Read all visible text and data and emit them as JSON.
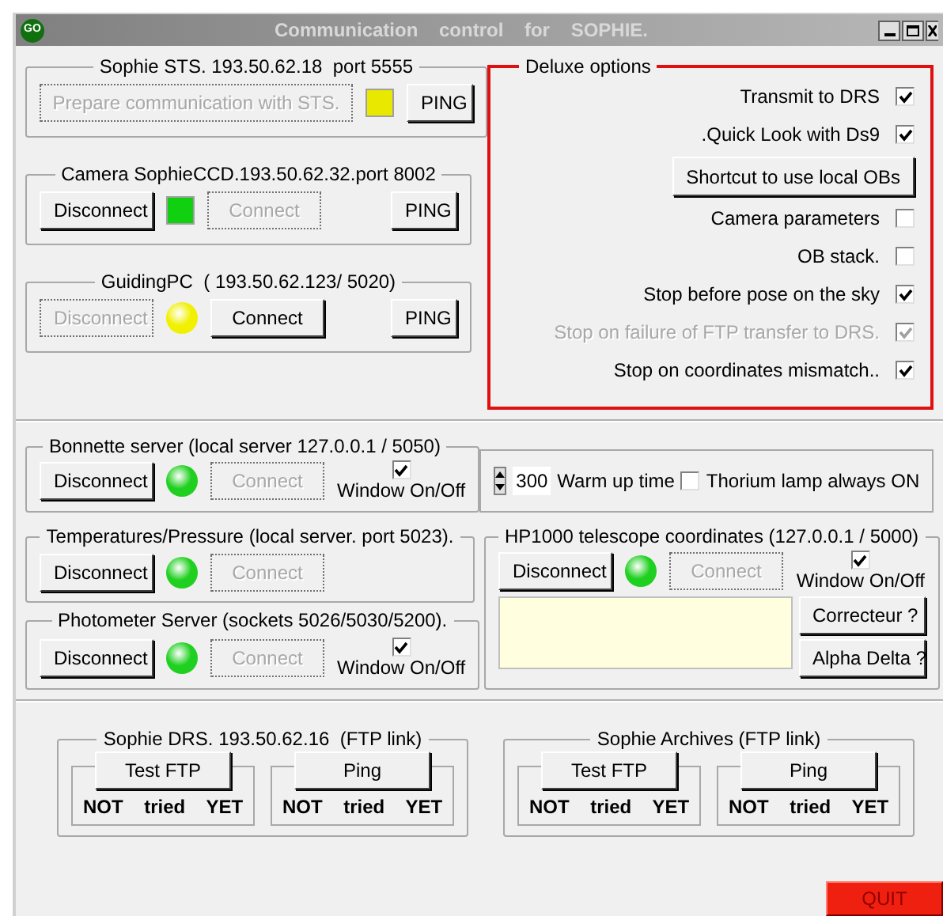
{
  "window": {
    "icon": "GO",
    "title": "Communication control for SOPHIE."
  },
  "connections": [
    {
      "title": "Sophie STS. 193.50.62.18  port 5555",
      "controls": [
        {
          "kind": "button",
          "label": "Prepare communication with STS.",
          "disabled": true
        },
        {
          "kind": "square_led",
          "color": "#e8e800"
        },
        {
          "kind": "button",
          "label": "PING",
          "disabled": false
        }
      ]
    },
    {
      "title": "Camera SophieCCD.193.50.62.32.port 8002",
      "controls": [
        {
          "kind": "button",
          "label": "Disconnect",
          "disabled": false
        },
        {
          "kind": "square_led",
          "color": "#10d010"
        },
        {
          "kind": "button",
          "label": "Connect",
          "disabled": true
        },
        {
          "kind": "button",
          "label": "PING",
          "disabled": false
        }
      ]
    },
    {
      "title": "GuidingPC  ( 193.50.62.123/ 5020)",
      "controls": [
        {
          "kind": "button",
          "label": "Disconnect",
          "disabled": true
        },
        {
          "kind": "round_led",
          "color": "#f0f000"
        },
        {
          "kind": "button",
          "label": "Connect",
          "disabled": false
        },
        {
          "kind": "button",
          "label": "PING",
          "disabled": false
        }
      ]
    }
  ],
  "deluxe": {
    "title": "Deluxe options",
    "rows": [
      {
        "kind": "checkbox",
        "label": "Transmit to DRS",
        "checked": true,
        "disabled": false
      },
      {
        "kind": "checkbox",
        "label": ".Quick Look with Ds9",
        "checked": true,
        "disabled": false
      },
      {
        "kind": "button",
        "label": "Shortcut to use local OBs"
      },
      {
        "kind": "checkbox",
        "label": "Camera parameters",
        "checked": false,
        "disabled": false
      },
      {
        "kind": "checkbox",
        "label": "OB stack.",
        "checked": false,
        "disabled": false
      },
      {
        "kind": "checkbox",
        "label": "Stop before pose on the sky",
        "checked": true,
        "disabled": false
      },
      {
        "kind": "checkbox",
        "label": "Stop on failure of FTP transfer to DRS.",
        "checked": true,
        "disabled": true
      },
      {
        "kind": "checkbox",
        "label": "Stop on coordinates mismatch..",
        "checked": true,
        "disabled": false
      }
    ]
  },
  "bonnette": {
    "title": "Bonnette server (local server 127.0.0.1 / 5050)",
    "controls": [
      {
        "kind": "button",
        "label": "Disconnect",
        "disabled": false
      },
      {
        "kind": "round_led",
        "color": "#20d020"
      },
      {
        "kind": "button",
        "label": "Connect",
        "disabled": true
      },
      {
        "kind": "toggle",
        "label": "Window On/Off",
        "checked": true
      }
    ]
  },
  "warmup": {
    "value": "300",
    "label": "Warm up time",
    "thorium": {
      "label": "Thorium lamp always ON",
      "checked": false
    }
  },
  "servers": [
    {
      "title": "Temperatures/Pressure (local server. port 5023).",
      "controls": [
        {
          "kind": "button",
          "label": "Disconnect",
          "disabled": false
        },
        {
          "kind": "round_led",
          "color": "#20d020"
        },
        {
          "kind": "button",
          "label": "Connect",
          "disabled": true
        }
      ]
    },
    {
      "title": "Photometer Server (sockets 5026/5030/5200).",
      "controls": [
        {
          "kind": "button",
          "label": "Disconnect",
          "disabled": false
        },
        {
          "kind": "round_led",
          "color": "#20d020"
        },
        {
          "kind": "button",
          "label": "Connect",
          "disabled": true
        },
        {
          "kind": "toggle",
          "label": "Window On/Off",
          "checked": true
        }
      ]
    }
  ],
  "telescope": {
    "title": "HP1000 telescope coordinates (127.0.0.1 / 5000)",
    "controls": [
      {
        "kind": "button",
        "label": "Disconnect",
        "disabled": false
      },
      {
        "kind": "round_led",
        "color": "#20d020"
      },
      {
        "kind": "button",
        "label": "Connect",
        "disabled": true
      },
      {
        "kind": "toggle",
        "label": "Window On/Off",
        "checked": true
      }
    ],
    "buttons": [
      "Correcteur ?",
      "Alpha Delta ?"
    ]
  },
  "ftp_links": [
    {
      "title": "Sophie DRS. 193.50.62.16  (FTP link)",
      "tests": [
        {
          "button": "Test FTP",
          "status": "NOT tried YET"
        },
        {
          "button": "Ping",
          "status": "NOT tried YET"
        }
      ]
    },
    {
      "title": "Sophie Archives (FTP link)",
      "tests": [
        {
          "button": "Test FTP",
          "status": "NOT tried YET"
        },
        {
          "button": "Ping",
          "status": "NOT tried YET"
        }
      ]
    }
  ],
  "quit": "QUIT"
}
